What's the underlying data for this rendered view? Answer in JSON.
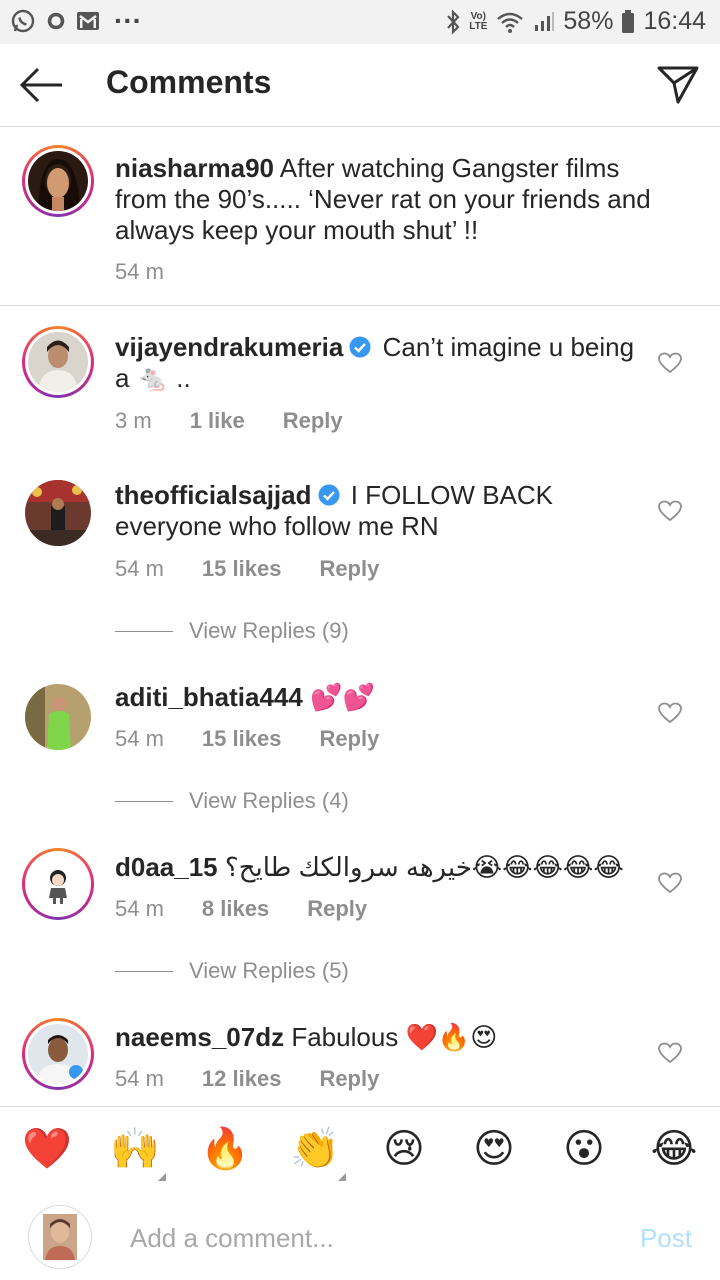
{
  "status_bar": {
    "icons": [
      "whatsapp-icon",
      "circle-icon",
      "gmail-icon",
      "more-dots-icon",
      "bluetooth-icon",
      "volte-icon",
      "wifi-icon",
      "signal-icon",
      "battery-icon"
    ],
    "dots": "···",
    "volte_top": "Vo)",
    "volte_bottom": "LTE",
    "battery": "58%",
    "time": "16:44"
  },
  "header": {
    "title": "Comments"
  },
  "caption": {
    "username": "niasharma90",
    "text": "After watching Gangster films from the 90’s..... ‘Never rat on your friends and always keep your mouth shut’ !!",
    "time": "54 m"
  },
  "comments": [
    {
      "username": "vijayendrakumeria",
      "verified": true,
      "text": "Can’t imagine u being a 🐁 ..",
      "time": "3 m",
      "likes": "1 like",
      "reply": "Reply"
    },
    {
      "username": "theofficialsajjad",
      "verified": true,
      "text": "I FOLLOW BACK everyone who follow me RN",
      "time": "54 m",
      "likes": "15 likes",
      "reply": "Reply",
      "view_replies": "View Replies (9)"
    },
    {
      "username": "aditi_bhatia444",
      "verified": false,
      "text": "💕💕",
      "time": "54 m",
      "likes": "15 likes",
      "reply": "Reply",
      "view_replies": "View Replies (4)"
    },
    {
      "username": "d0aa_15",
      "verified": false,
      "text": "خيرهه سروالكك طايح؟😭😂😂😂😂",
      "time": "54 m",
      "likes": "8 likes",
      "reply": "Reply",
      "view_replies": "View Replies (5)"
    },
    {
      "username": "naeems_07dz",
      "verified": false,
      "text": "Fabulous ❤️🔥😍",
      "time": "54 m",
      "likes": "12 likes",
      "reply": "Reply"
    }
  ],
  "emoji_bar": [
    "❤️",
    "🙌",
    "🔥",
    "👏",
    "😢",
    "😍",
    "😮",
    "😂"
  ],
  "composer": {
    "placeholder": "Add a comment...",
    "post_label": "Post"
  },
  "colors": {
    "text": "#262626",
    "secondary": "#8e8e8e",
    "verified": "#3897f0",
    "post_disabled": "#b2dffc",
    "divider": "#dbdbdb"
  }
}
